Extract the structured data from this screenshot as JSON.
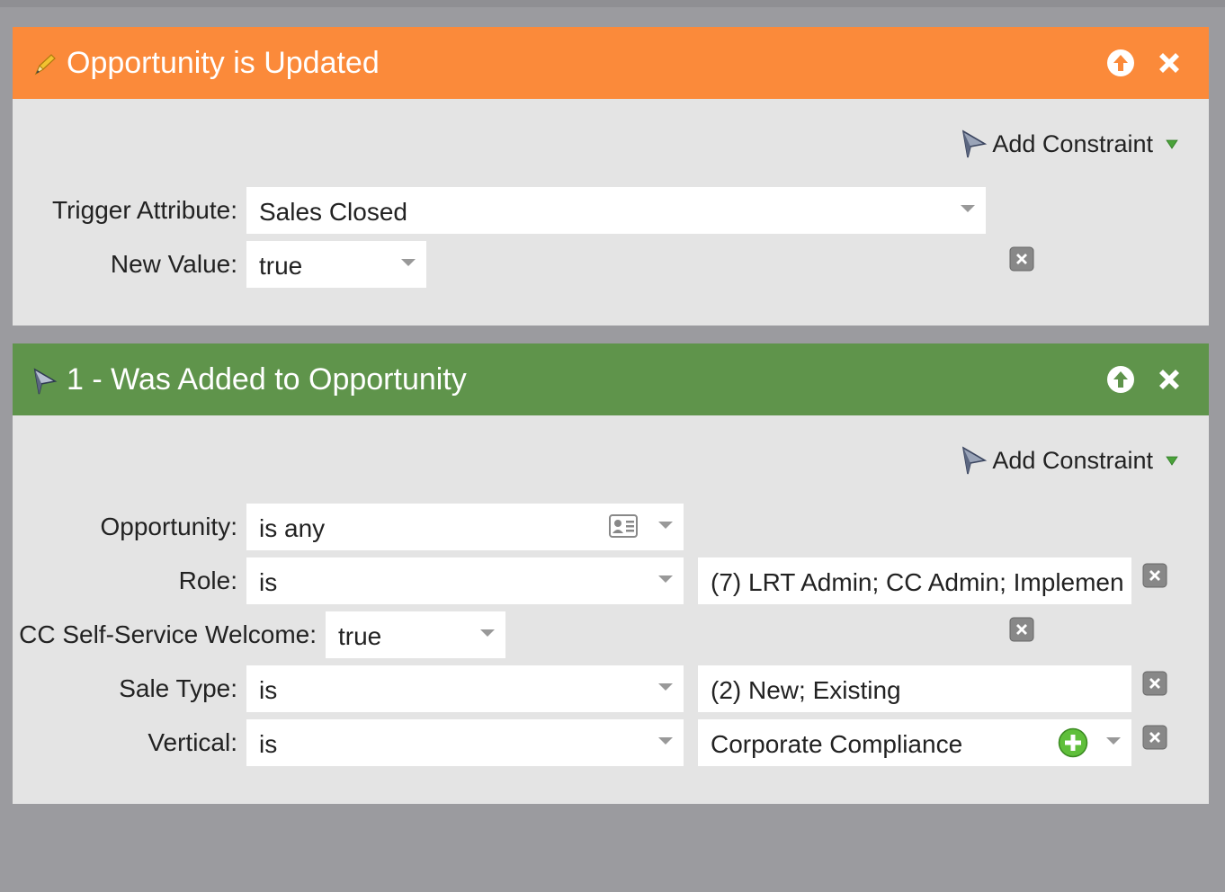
{
  "panels": [
    {
      "title": "Opportunity is Updated",
      "header_color": "#fb8a3a",
      "header_icon": "pencil-icon",
      "add_constraint_label": "Add Constraint",
      "rows": [
        {
          "label": "Trigger Attribute:",
          "value": "Sales Closed"
        },
        {
          "label": "New Value:",
          "value": "true"
        }
      ]
    },
    {
      "title": "1 - Was Added to Opportunity",
      "header_color": "#5f944b",
      "header_icon": "filter-icon",
      "add_constraint_label": "Add Constraint",
      "rows": [
        {
          "label": "Opportunity:",
          "operator": "is any"
        },
        {
          "label": "Role:",
          "operator": "is",
          "value": "(7) LRT Admin; CC Admin; Implemen"
        },
        {
          "label": "CC Self-Service Welcome:",
          "operator": "true"
        },
        {
          "label": "Sale Type:",
          "operator": "is",
          "value": "(2) New; Existing"
        },
        {
          "label": "Vertical:",
          "operator": "is",
          "value": "Corporate Compliance"
        }
      ]
    }
  ]
}
